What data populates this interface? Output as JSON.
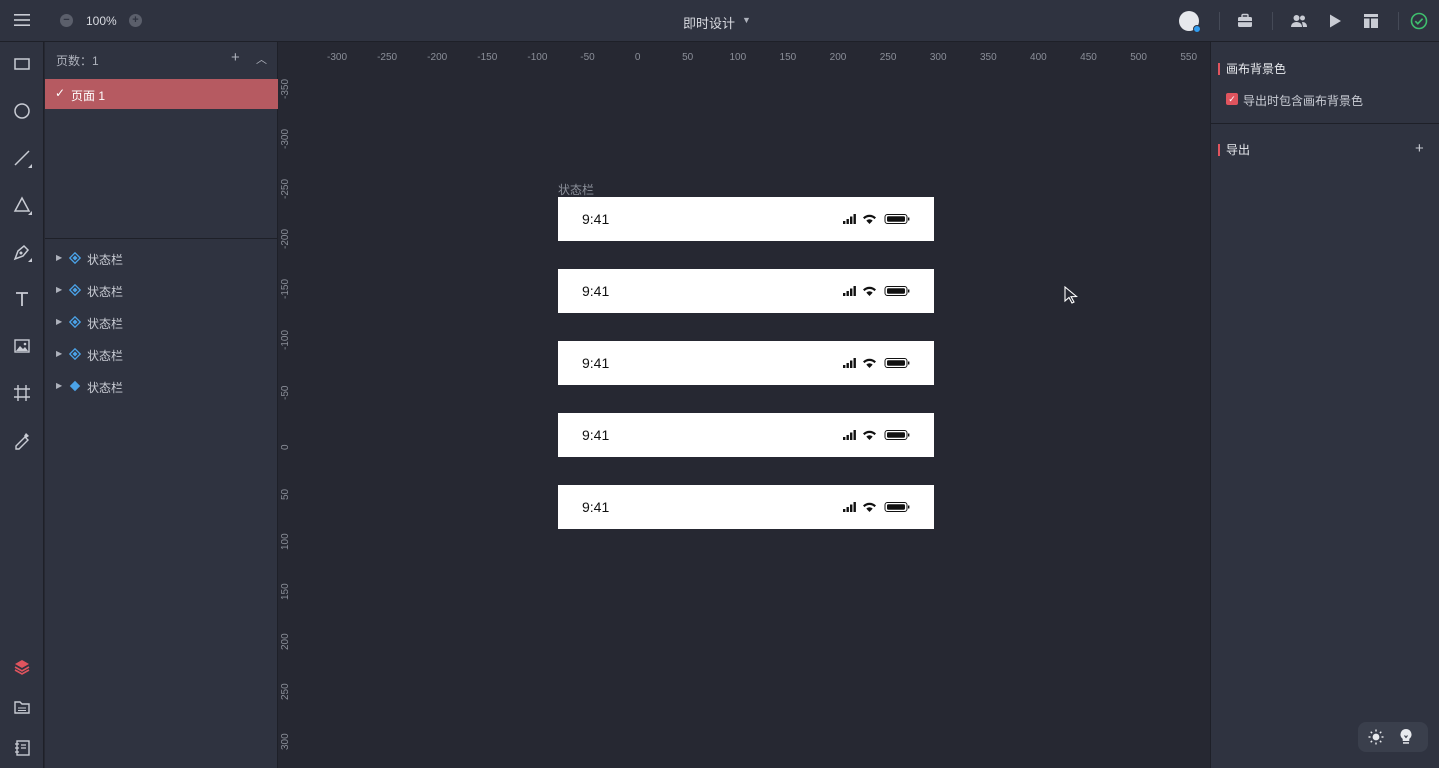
{
  "topbar": {
    "zoom": "100%",
    "title": "即时设计",
    "icons": [
      "menu-icon",
      "zoom-out-icon",
      "zoom-in-icon",
      "chevron-down-icon",
      "avatar",
      "plugin-icon",
      "team-icon",
      "play-icon",
      "layout-icon",
      "sync-ok-icon"
    ]
  },
  "pages": {
    "header": "页数：1",
    "items": [
      {
        "label": "页面 1",
        "selected": true
      }
    ]
  },
  "layers": [
    {
      "label": "状态栏"
    },
    {
      "label": "状态栏"
    },
    {
      "label": "状态栏"
    },
    {
      "label": "状态栏"
    },
    {
      "label": "状态栏"
    }
  ],
  "canvas": {
    "ruler_h": [
      "-300",
      "-250",
      "-200",
      "-150",
      "-100",
      "-50",
      "0",
      "50",
      "100",
      "150",
      "200",
      "250",
      "300",
      "350",
      "400",
      "450",
      "500",
      "550"
    ],
    "ruler_v": [
      "-350",
      "-300",
      "-250",
      "-200",
      "-150",
      "-100",
      "-50",
      "0",
      "50",
      "100",
      "150",
      "200",
      "250",
      "300"
    ],
    "frame_label": "状态栏",
    "statusbars": [
      {
        "time": "9:41"
      },
      {
        "time": "9:41"
      },
      {
        "time": "9:41"
      },
      {
        "time": "9:41"
      },
      {
        "time": "9:41"
      }
    ]
  },
  "right_panel": {
    "bg_title": "画布背景色",
    "bg_checkbox_label": "导出时包含画布背景色",
    "bg_checkbox_checked": true,
    "export_title": "导出"
  },
  "colors": {
    "accent": "#e0545e",
    "selected_page": "#b65a61",
    "panel": "#2f3340",
    "canvas": "#262832"
  }
}
